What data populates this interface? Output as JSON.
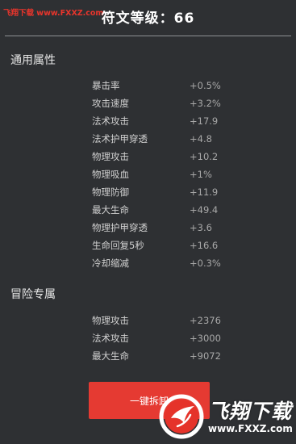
{
  "watermark_top": "飞翔下载 www.FXXZ.com",
  "title": "符文等级：66",
  "sections": [
    {
      "title": "通用属性",
      "attributes": [
        {
          "name": "暴击率",
          "value": "+0.5%"
        },
        {
          "name": "攻击速度",
          "value": "+3.2%"
        },
        {
          "name": "法术攻击",
          "value": "+17.9"
        },
        {
          "name": "法术护甲穿透",
          "value": "+4.8"
        },
        {
          "name": "物理攻击",
          "value": "+10.2"
        },
        {
          "name": "物理吸血",
          "value": "+1%"
        },
        {
          "name": "物理防御",
          "value": "+11.9"
        },
        {
          "name": "最大生命",
          "value": "+49.4"
        },
        {
          "name": "物理护甲穿透",
          "value": "+3.6"
        },
        {
          "name": "生命回复5秒",
          "value": "+16.6"
        },
        {
          "name": "冷却缩减",
          "value": "+0.3%"
        }
      ]
    },
    {
      "title": "冒险专属",
      "attributes": [
        {
          "name": "物理攻击",
          "value": "+2376"
        },
        {
          "name": "法术攻击",
          "value": "+3000"
        },
        {
          "name": "最大生命",
          "value": "+9072"
        }
      ]
    }
  ],
  "disassemble_button": "一键拆卸",
  "brand": {
    "name": "飞翔下载",
    "url": "www.FXXZ.com"
  },
  "colors": {
    "background": "#2e3033",
    "button": "#e53a32",
    "accent_red": "#e8352c"
  }
}
